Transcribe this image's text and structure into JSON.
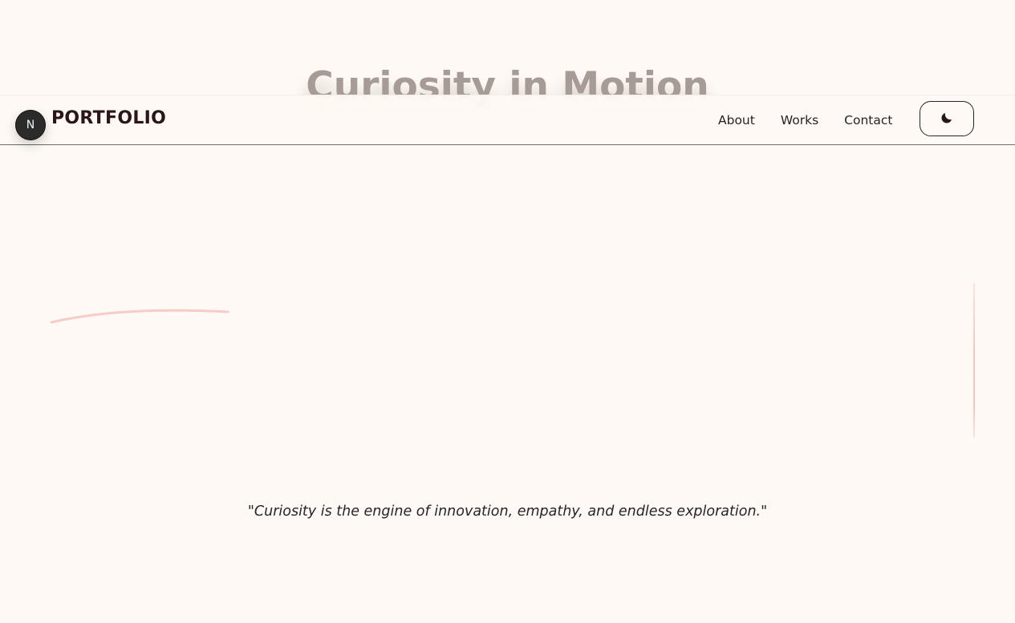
{
  "hero": {
    "title": "Curiosity in Motion"
  },
  "header": {
    "logo_letter": "N",
    "brand": "PORTFOLIO",
    "nav": [
      {
        "label": "About"
      },
      {
        "label": "Works"
      },
      {
        "label": "Contact"
      }
    ],
    "theme_toggle_icon": "moon-icon"
  },
  "quote": {
    "text": "\"Curiosity is the engine of innovation, empathy, and endless exploration.\""
  },
  "colors": {
    "background": "#fef9f4",
    "text": "#2a1f1f",
    "hero_title": "#a69b95",
    "accent_stroke": "#f6c4bc",
    "logo_bg": "#2b2b2b"
  }
}
